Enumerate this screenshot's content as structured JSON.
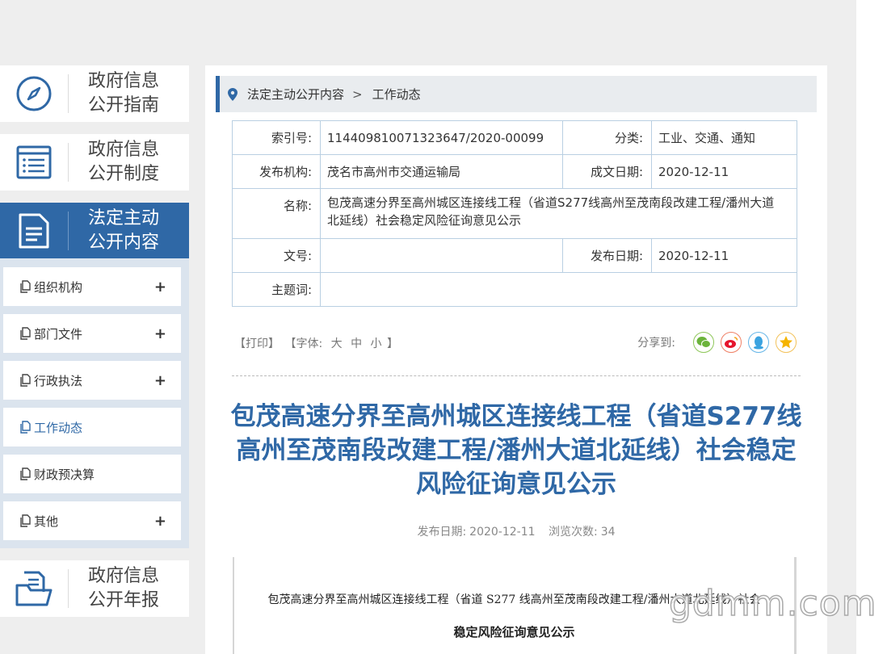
{
  "sidebar": {
    "cards": [
      {
        "label_line1": "政府信息",
        "label_line2": "公开指南",
        "icon": "compass-icon"
      },
      {
        "label_line1": "政府信息",
        "label_line2": "公开制度",
        "icon": "list-document-icon"
      },
      {
        "label_line1": "法定主动",
        "label_line2": "公开内容",
        "icon": "document-icon",
        "active": true
      },
      {
        "label_line1": "政府信息",
        "label_line2": "公开年报",
        "icon": "folder-document-icon"
      }
    ],
    "submenu": [
      {
        "label": "组织机构",
        "expand": "+"
      },
      {
        "label": "部门文件",
        "expand": "+"
      },
      {
        "label": "行政执法",
        "expand": "+"
      },
      {
        "label": "工作动态",
        "expand": "",
        "current": true
      },
      {
        "label": "财政预决算",
        "expand": ""
      },
      {
        "label": "其他",
        "expand": "+"
      }
    ]
  },
  "breadcrumb": {
    "items": [
      "法定主动公开内容",
      "工作动态"
    ],
    "separator": ">"
  },
  "info_table": {
    "index_label": "索引号:",
    "index_value": "114409810071323647/2020-00099",
    "category_label": "分类:",
    "category_value": "工业、交通、通知",
    "publisher_label": "发布机构:",
    "publisher_value": "茂名市高州市交通运输局",
    "created_label": "成文日期:",
    "created_value": "2020-12-11",
    "name_label": "名称:",
    "name_value": "包茂高速分界至高州城区连接线工程（省道S277线高州至茂南段改建工程/潘州大道北延线）社会稳定风险征询意见公示",
    "docno_label": "文号:",
    "docno_value": "",
    "pubdate_label": "发布日期:",
    "pubdate_value": "2020-12-11",
    "keywords_label": "主题词:",
    "keywords_value": ""
  },
  "tools": {
    "print": "【打印】",
    "font_prefix": "【字体:",
    "font_large": "大",
    "font_medium": "中",
    "font_small": "小",
    "font_suffix": "】"
  },
  "share": {
    "label": "分享到:",
    "buttons": [
      "wechat-icon",
      "weibo-icon",
      "qq-icon",
      "qzone-icon"
    ]
  },
  "article": {
    "title": "包茂高速分界至高州城区连接线工程（省道S277线高州至茂南段改建工程/潘州大道北延线）社会稳定风险征询意见公示",
    "date_label": "发布日期:",
    "date_value": "2020-12-11",
    "views_label": "浏览次数:",
    "views_value": "34",
    "doc_line1": "包茂高速分界至高州城区连接线工程（省道 S277 线高州至茂南段改建工程/潘州大道北延线）社会",
    "doc_line2": "稳定风险征询意见公示"
  },
  "watermark": "gdmm.com",
  "colors": {
    "brand": "#2f68a6",
    "page_bg": "#eeeeee",
    "submenu_bg": "#dbe4ee",
    "table_border": "#b9cfe2"
  }
}
